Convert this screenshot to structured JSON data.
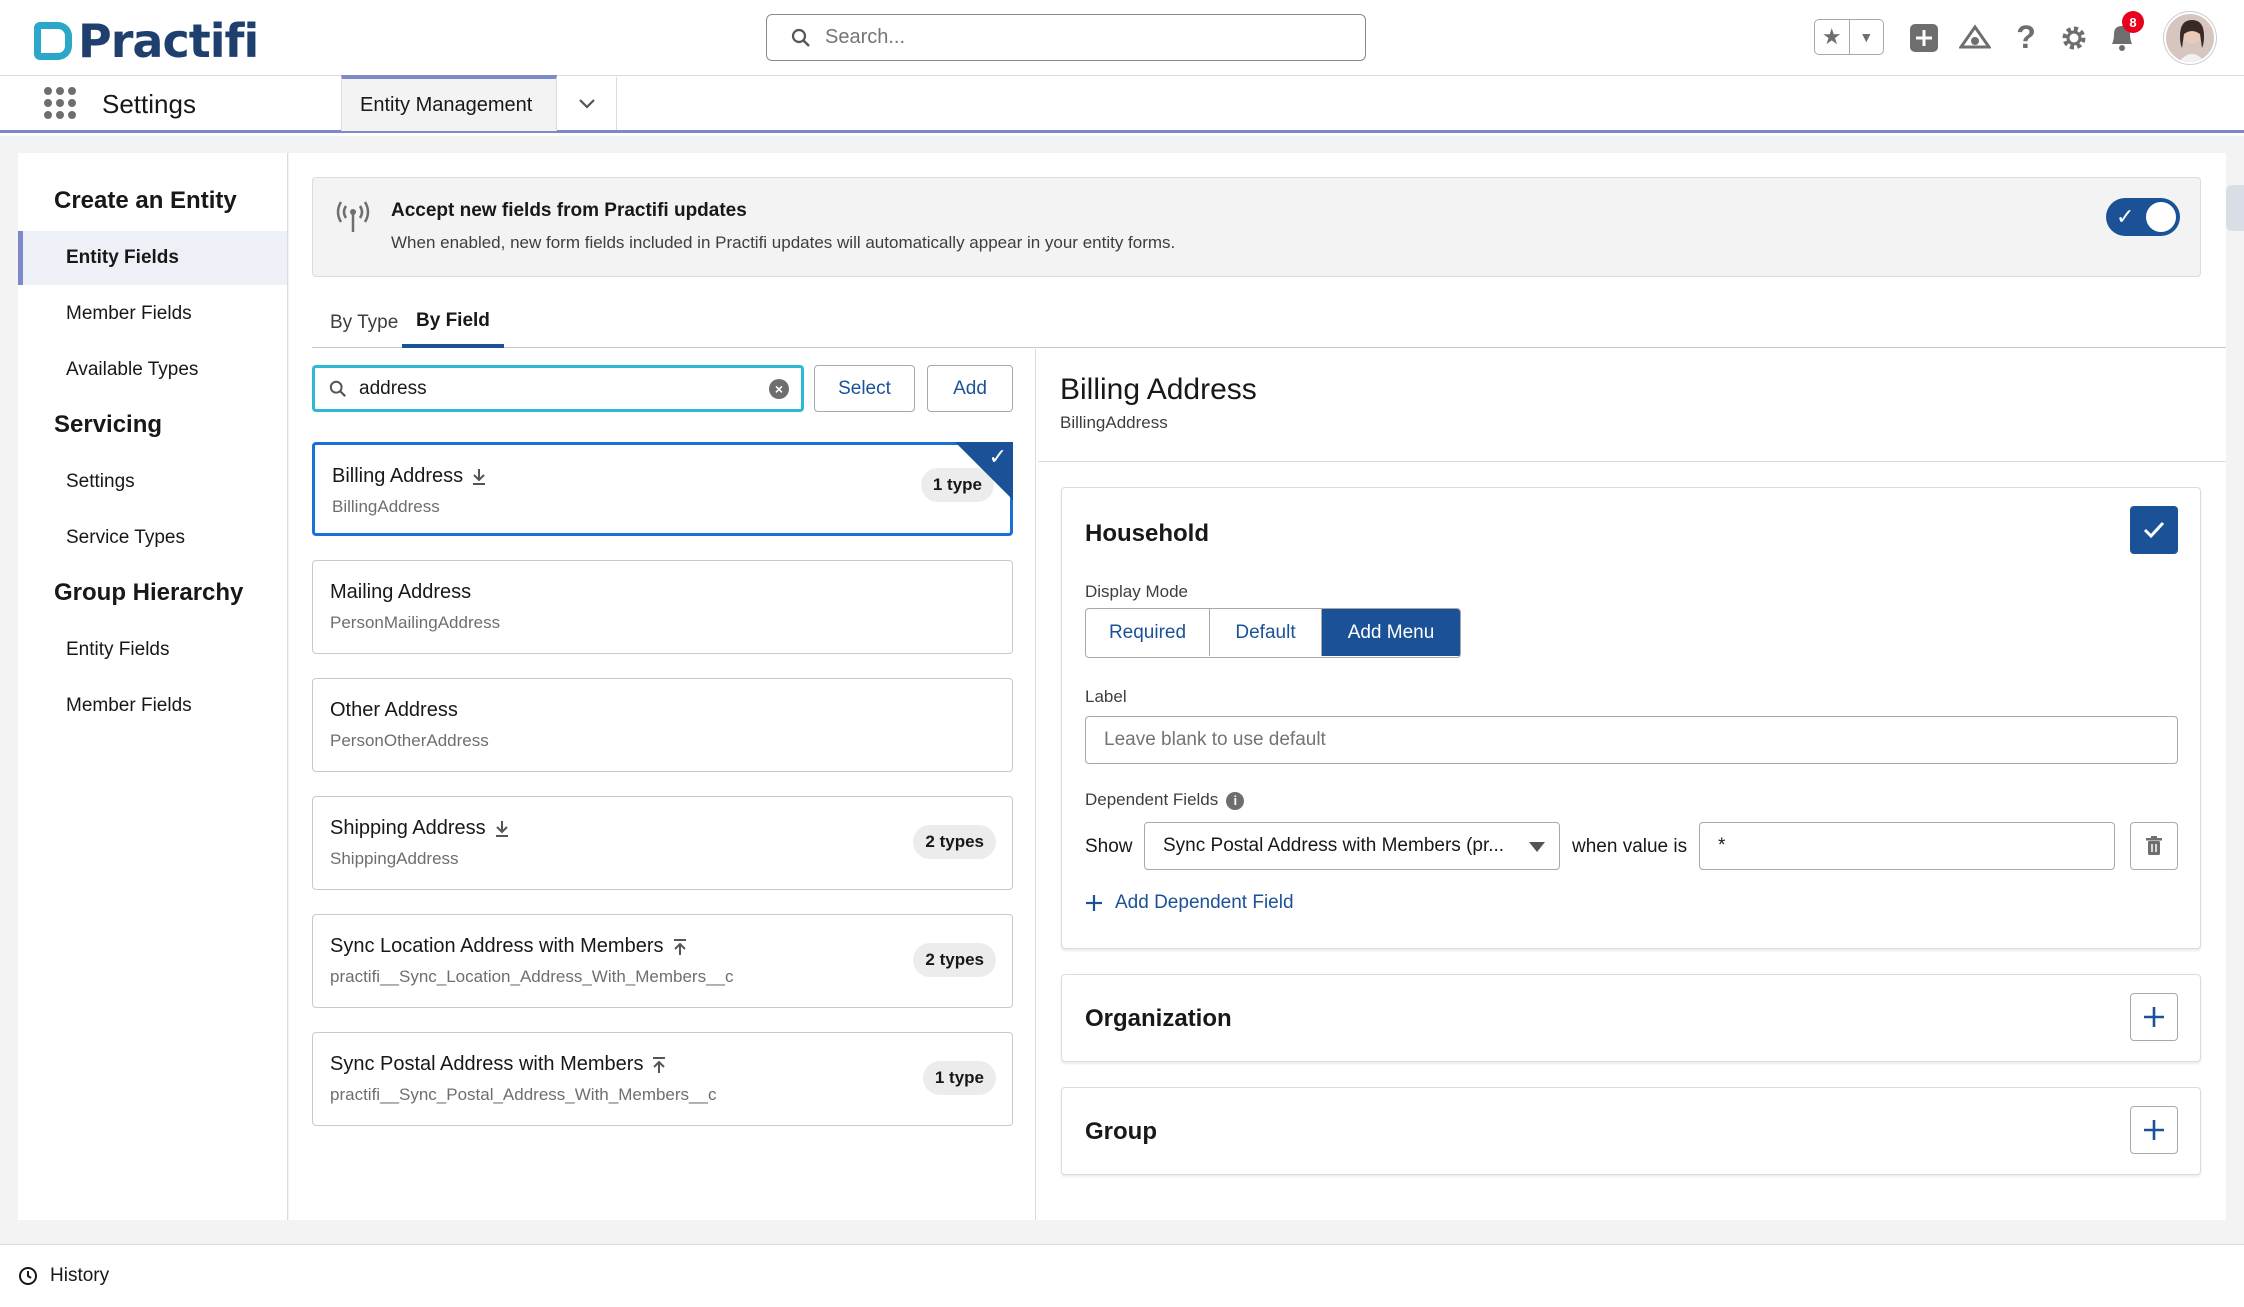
{
  "header": {
    "logo_text": "Practifi",
    "search_placeholder": "Search...",
    "notification_count": "8"
  },
  "nav": {
    "app_name": "Settings",
    "tab_label": "Entity Management"
  },
  "sidebar": {
    "sections": [
      {
        "title": "Create an Entity",
        "items": [
          "Entity Fields",
          "Member Fields",
          "Available Types"
        ]
      },
      {
        "title": "Servicing",
        "items": [
          "Settings",
          "Service Types"
        ]
      },
      {
        "title": "Group Hierarchy",
        "items": [
          "Entity Fields",
          "Member Fields"
        ]
      }
    ],
    "active_item": "Entity Fields"
  },
  "banner": {
    "title": "Accept new fields from Practifi updates",
    "description": "When enabled, new form fields included in Practifi updates will automatically appear in your entity forms.",
    "toggle_on": true
  },
  "tabs": [
    "By Type",
    "By Field"
  ],
  "active_tab": "By Field",
  "field_search": {
    "value": "address"
  },
  "buttons": {
    "select": "Select",
    "add": "Add"
  },
  "fields": [
    {
      "name": "Billing Address",
      "api": "BillingAddress",
      "badge": "1 type",
      "icon": "download-icon",
      "selected": true
    },
    {
      "name": "Mailing Address",
      "api": "PersonMailingAddress",
      "badge": "",
      "icon": ""
    },
    {
      "name": "Other Address",
      "api": "PersonOtherAddress",
      "badge": "",
      "icon": ""
    },
    {
      "name": "Shipping Address",
      "api": "ShippingAddress",
      "badge": "2 types",
      "icon": "download-icon"
    },
    {
      "name": "Sync Location Address with Members",
      "api": "practifi__Sync_Location_Address_With_Members__c",
      "badge": "2 types",
      "icon": "upload-icon"
    },
    {
      "name": "Sync Postal Address with Members",
      "api": "practifi__Sync_Postal_Address_With_Members__c",
      "badge": "1 type",
      "icon": "upload-icon"
    }
  ],
  "detail": {
    "title": "Billing Address",
    "api": "BillingAddress",
    "household": {
      "title": "Household",
      "display_mode_label": "Display Mode",
      "modes": [
        "Required",
        "Default",
        "Add Menu"
      ],
      "active_mode": "Add Menu",
      "label_label": "Label",
      "label_placeholder": "Leave blank to use default",
      "dependent_label": "Dependent Fields",
      "show_label": "Show",
      "dependent_field": "Sync Postal Address with Members (pr...",
      "when_label": "when value is",
      "when_value": "*",
      "add_dependent": "Add Dependent Field"
    },
    "organization": {
      "title": "Organization"
    },
    "group": {
      "title": "Group"
    }
  },
  "footer": {
    "history": "History"
  }
}
